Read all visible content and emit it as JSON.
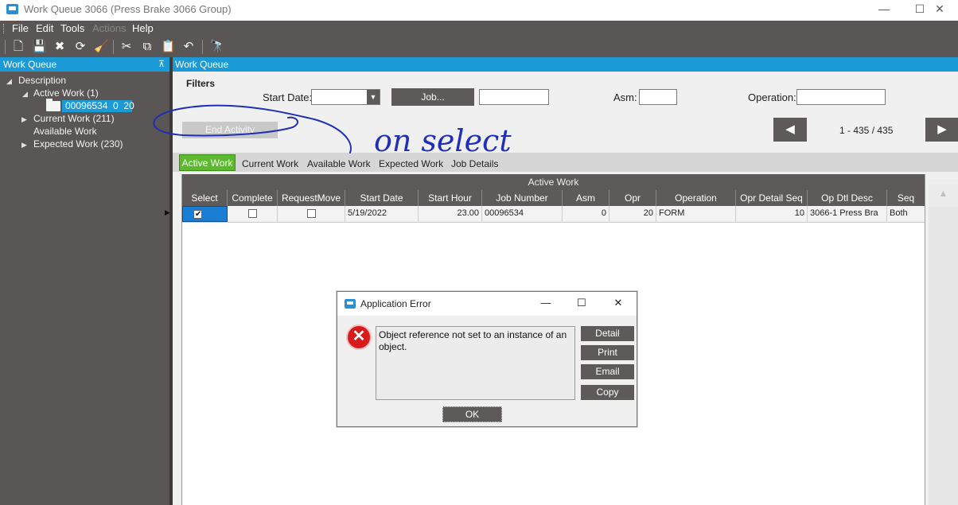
{
  "window": {
    "title": "Work Queue 3066 (Press Brake 3066 Group)",
    "minimize_glyph": "—",
    "maximize_glyph": "☐",
    "close_glyph": "✕"
  },
  "menu": {
    "file": "File",
    "edit": "Edit",
    "tools": "Tools",
    "actions": "Actions",
    "help": "Help"
  },
  "toolbar": {
    "icons": [
      "new-icon",
      "save-icon",
      "delete-icon",
      "refresh-icon",
      "clear-icon",
      "cut-icon",
      "copy-icon",
      "paste-icon",
      "undo-icon",
      "search-binoculars-icon"
    ],
    "glyphs": {
      "new": "🗋",
      "save": "💾",
      "delete": "✖",
      "refresh": "⟳",
      "clear": "🧹",
      "cut": "✂",
      "copy": "⧉",
      "paste": "📋",
      "undo": "↶",
      "search": "🔭"
    }
  },
  "left_panel": {
    "title": "Work Queue",
    "pin_glyph": "⊼",
    "tree": {
      "root": "Description",
      "active_work": "Active Work (1)",
      "active_child": "00096534  0  20",
      "current_work": "Current Work (211)",
      "available_work": "Available Work",
      "expected_work": "Expected Work (230)"
    }
  },
  "main": {
    "title": "Work Queue",
    "filters": {
      "heading": "Filters",
      "start_date_label": "Start Date:",
      "start_date_value": "",
      "job_button": "Job...",
      "job_value": "",
      "asm_label": "Asm:",
      "asm_value": "",
      "operation_label": "Operation:",
      "operation_value": ""
    },
    "end_activity_button": "End Activity",
    "pager": {
      "prev_glyph": "◀",
      "next_glyph": "▶",
      "text": "1 - 435 / 435"
    },
    "tabs": {
      "active_work": "Active Work",
      "current_work": "Current Work",
      "available_work": "Available Work",
      "expected_work": "Expected Work",
      "job_details": "Job Details"
    },
    "grid": {
      "title": "Active Work",
      "columns": [
        "Select",
        "Complete",
        "RequestMove",
        "Start Date",
        "Start Hour",
        "Job Number",
        "Asm",
        "Opr",
        "Operation",
        "Opr Detail Seq",
        "Op Dtl Desc",
        "Seq"
      ],
      "rows": [
        {
          "select": true,
          "complete": false,
          "request_move": false,
          "start_date": "5/19/2022",
          "start_hour": "23.00",
          "job_number": "00096534",
          "asm": "0",
          "opr": "20",
          "operation": "FORM",
          "opr_detail_seq": "10",
          "op_dtl_desc": "3066-1 Press Bra",
          "seq": "Both"
        }
      ]
    }
  },
  "dialog": {
    "title": "Application Error",
    "message": "Object reference not set to an instance of an object.",
    "buttons": {
      "detail": "Detail",
      "print": "Print",
      "email": "Email",
      "copy": "Copy",
      "ok": "OK"
    }
  },
  "annotation": {
    "handwritten_text": "on select",
    "color": "#1f2fb8"
  },
  "colors": {
    "accent_blue": "#1a9ad6",
    "dark_gray": "#5a5656",
    "active_tab_green": "#5cb82e",
    "error_red": "#d71a1a"
  }
}
